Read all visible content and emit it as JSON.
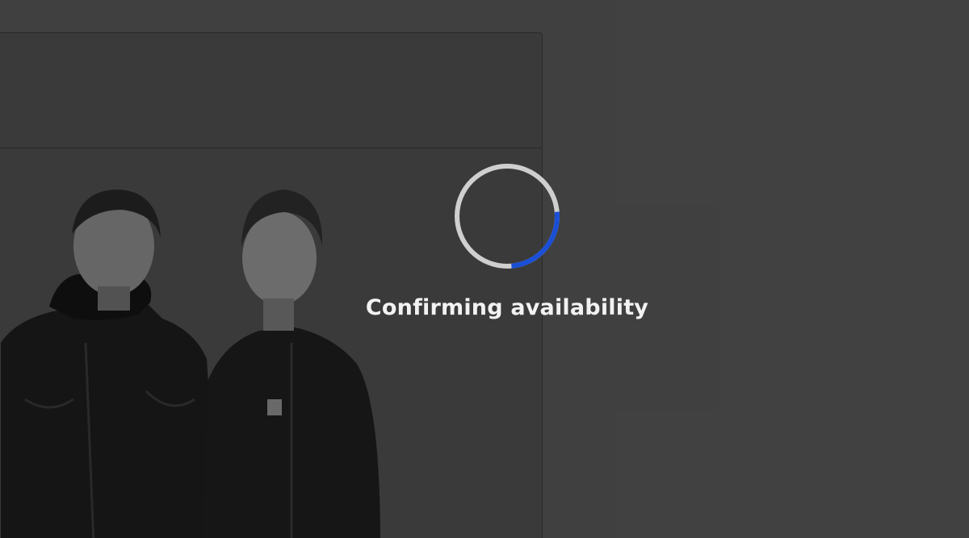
{
  "loading": {
    "message": "Confirming availability",
    "spinner_track_color": "#cfcfcf",
    "spinner_arc_color": "#1a4fd6",
    "progress_fraction": 0.25
  },
  "background": {
    "page_color": "#424242",
    "image_description_icon": "artist-photo-icon"
  }
}
